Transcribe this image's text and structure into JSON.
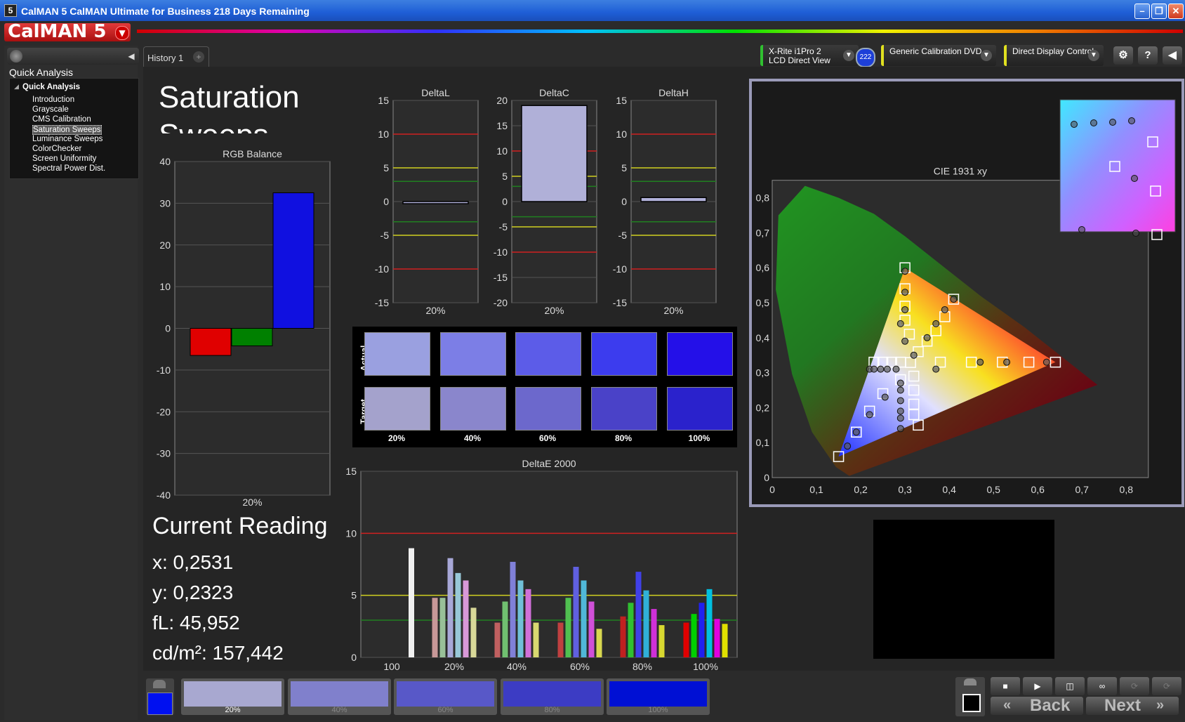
{
  "window": {
    "title": "CalMAN 5 CalMAN Ultimate for Business 218 Days Remaining",
    "app_icon": "5"
  },
  "logo": {
    "text": "CalMAN 5"
  },
  "tabs": [
    {
      "label": "History 1"
    }
  ],
  "left_panel": {
    "header": "Quick Analysis",
    "tree_header": "Quick Analysis",
    "items": [
      "Introduction",
      "Grayscale",
      "CMS Calibration",
      "Saturation Sweeps",
      "Luminance Sweeps",
      "ColorChecker",
      "Screen Uniformity",
      "Spectral Power Dist."
    ],
    "selected": "Saturation Sweeps"
  },
  "devices": {
    "meter": {
      "line1": "X-Rite i1Pro 2",
      "line2": "LCD Direct View",
      "badge": "222"
    },
    "source": {
      "label": "Generic Calibration DVD"
    },
    "display": {
      "label": "Direct Display Control"
    }
  },
  "page": {
    "title_line1": "Saturation",
    "title_line2": "Sweeps"
  },
  "current_reading": {
    "title": "Current Reading",
    "x": "x: 0,2531",
    "y": "y: 0,2323",
    "fl": "fL: 45,952",
    "cdm2": "cd/m²: 157,442"
  },
  "swatch_labels": {
    "actual": "Actual",
    "target": "Target",
    "steps": [
      "20%",
      "40%",
      "60%",
      "80%",
      "100%"
    ]
  },
  "swatch_colors": {
    "actual": [
      "#9aa0e0",
      "#7c7ee6",
      "#5c5ce8",
      "#3c3cee",
      "#2410e8"
    ],
    "target": [
      "#a4a2cc",
      "#8a86cc",
      "#6c68cc",
      "#4a42c8",
      "#2a22cc"
    ]
  },
  "patches": {
    "current_color": "#0010f0",
    "labels": [
      "20%",
      "40%",
      "60%",
      "80%",
      "100%"
    ],
    "colors": [
      "#a8a8d0",
      "#8080cc",
      "#5858c8",
      "#3c3cc4",
      "#0010d4"
    ]
  },
  "nav": {
    "back": "Back",
    "next": "Next"
  },
  "chart_data": [
    {
      "type": "bar",
      "title": "RGB Balance",
      "categories": [
        "20%"
      ],
      "series": [
        {
          "color": "#e00000",
          "values": [
            -6.5
          ]
        },
        {
          "color": "#008000",
          "values": [
            -4.2
          ]
        },
        {
          "color": "#1010e0",
          "values": [
            32.5
          ]
        }
      ],
      "ylim": [
        -40,
        40
      ],
      "yticks": [
        40,
        30,
        20,
        10,
        0,
        -10,
        -20,
        -30,
        -40
      ]
    },
    {
      "type": "bar",
      "title": "DeltaL",
      "categories": [
        "20%"
      ],
      "values": [
        -0.3
      ],
      "ylim": [
        -15,
        15
      ],
      "yticks": [
        15,
        10,
        5,
        0,
        -5,
        -10,
        -15
      ],
      "reference_lines": [
        {
          "y": 10,
          "color": "#d02020"
        },
        {
          "y": 5,
          "color": "#d0d020"
        },
        {
          "y": 3,
          "color": "#208020"
        },
        {
          "y": -3,
          "color": "#208020"
        },
        {
          "y": -5,
          "color": "#d0d020"
        },
        {
          "y": -10,
          "color": "#d02020"
        }
      ]
    },
    {
      "type": "bar",
      "title": "DeltaC",
      "categories": [
        "20%"
      ],
      "values": [
        19
      ],
      "ylim": [
        -20,
        20
      ],
      "yticks": [
        20,
        15,
        10,
        5,
        0,
        -5,
        -10,
        -15,
        -20
      ],
      "reference_lines": [
        {
          "y": 10,
          "color": "#d02020"
        },
        {
          "y": 5,
          "color": "#d0d020"
        },
        {
          "y": 3,
          "color": "#208020"
        },
        {
          "y": -3,
          "color": "#208020"
        },
        {
          "y": -5,
          "color": "#d0d020"
        },
        {
          "y": -10,
          "color": "#d02020"
        }
      ]
    },
    {
      "type": "bar",
      "title": "DeltaH",
      "categories": [
        "20%"
      ],
      "values": [
        0.6
      ],
      "ylim": [
        -15,
        15
      ],
      "yticks": [
        15,
        10,
        5,
        0,
        -5,
        -10,
        -15
      ],
      "reference_lines": [
        {
          "y": 10,
          "color": "#d02020"
        },
        {
          "y": 5,
          "color": "#d0d020"
        },
        {
          "y": 3,
          "color": "#208020"
        },
        {
          "y": -3,
          "color": "#208020"
        },
        {
          "y": -5,
          "color": "#d0d020"
        },
        {
          "y": -10,
          "color": "#d02020"
        }
      ]
    },
    {
      "type": "bar",
      "title": "DeltaE 2000",
      "categories": [
        "100",
        "20%",
        "40%",
        "60%",
        "80%",
        "100%"
      ],
      "ylim": [
        0,
        15
      ],
      "yticks": [
        15,
        10,
        5,
        0
      ],
      "reference_lines": [
        {
          "y": 10,
          "color": "#d02020"
        },
        {
          "y": 5,
          "color": "#d0d020"
        },
        {
          "y": 3,
          "color": "#208020"
        }
      ],
      "groups": [
        {
          "bars": [
            {
              "v": 8.8,
              "c": "#f0f0f0"
            }
          ]
        },
        {
          "bars": [
            {
              "v": 4.8,
              "c": "#c89898"
            },
            {
              "v": 4.8,
              "c": "#98c098"
            },
            {
              "v": 8.0,
              "c": "#a8a8d8"
            },
            {
              "v": 6.8,
              "c": "#98c8d8"
            },
            {
              "v": 6.2,
              "c": "#d898d8"
            },
            {
              "v": 4.0,
              "c": "#d8d898"
            }
          ]
        },
        {
          "bars": [
            {
              "v": 2.8,
              "c": "#c06060"
            },
            {
              "v": 4.5,
              "c": "#70c070"
            },
            {
              "v": 7.7,
              "c": "#8080d8"
            },
            {
              "v": 6.2,
              "c": "#70c0d8"
            },
            {
              "v": 5.5,
              "c": "#d070d8"
            },
            {
              "v": 2.8,
              "c": "#d8d870"
            }
          ]
        },
        {
          "bars": [
            {
              "v": 2.8,
              "c": "#c04040"
            },
            {
              "v": 4.8,
              "c": "#50c050"
            },
            {
              "v": 7.3,
              "c": "#6060e0"
            },
            {
              "v": 6.2,
              "c": "#50b8d8"
            },
            {
              "v": 4.5,
              "c": "#d050d8"
            },
            {
              "v": 2.3,
              "c": "#d8d850"
            }
          ]
        },
        {
          "bars": [
            {
              "v": 3.3,
              "c": "#c02020"
            },
            {
              "v": 4.4,
              "c": "#30c030"
            },
            {
              "v": 6.9,
              "c": "#4040e8"
            },
            {
              "v": 5.4,
              "c": "#30b0d8"
            },
            {
              "v": 3.9,
              "c": "#d030d8"
            },
            {
              "v": 2.6,
              "c": "#d8d830"
            }
          ]
        },
        {
          "bars": [
            {
              "v": 2.8,
              "c": "#e00000"
            },
            {
              "v": 3.5,
              "c": "#00d000"
            },
            {
              "v": 4.4,
              "c": "#2020f0"
            },
            {
              "v": 5.5,
              "c": "#00c0e0"
            },
            {
              "v": 3.1,
              "c": "#e000e0"
            },
            {
              "v": 2.7,
              "c": "#e0e000"
            }
          ]
        }
      ]
    },
    {
      "type": "scatter",
      "title": "CIE 1931 xy",
      "xlim": [
        0,
        0.85
      ],
      "ylim": [
        0,
        0.85
      ],
      "xticks": [
        "0",
        "0,1",
        "0,2",
        "0,3",
        "0,4",
        "0,5",
        "0,6",
        "0,7",
        "0,8"
      ],
      "yticks": [
        "0",
        "0,1",
        "0,2",
        "0,3",
        "0,4",
        "0,5",
        "0,6",
        "0,7",
        "0,8"
      ],
      "gamut": [
        [
          0.64,
          0.33
        ],
        [
          0.3,
          0.6
        ],
        [
          0.15,
          0.06
        ]
      ],
      "targets": [
        [
          0.3,
          0.6
        ],
        [
          0.3,
          0.54
        ],
        [
          0.3,
          0.49
        ],
        [
          0.3,
          0.45
        ],
        [
          0.31,
          0.41
        ],
        [
          0.41,
          0.51
        ],
        [
          0.39,
          0.46
        ],
        [
          0.37,
          0.42
        ],
        [
          0.35,
          0.39
        ],
        [
          0.33,
          0.36
        ],
        [
          0.64,
          0.33
        ],
        [
          0.58,
          0.33
        ],
        [
          0.52,
          0.33
        ],
        [
          0.45,
          0.33
        ],
        [
          0.38,
          0.33
        ],
        [
          0.3127,
          0.329
        ],
        [
          0.29,
          0.28
        ],
        [
          0.25,
          0.24
        ],
        [
          0.22,
          0.19
        ],
        [
          0.19,
          0.13
        ],
        [
          0.15,
          0.06
        ],
        [
          0.32,
          0.29
        ],
        [
          0.32,
          0.25
        ],
        [
          0.32,
          0.21
        ],
        [
          0.32,
          0.18
        ],
        [
          0.33,
          0.15
        ],
        [
          0.23,
          0.33
        ],
        [
          0.25,
          0.33
        ],
        [
          0.27,
          0.33
        ],
        [
          0.29,
          0.33
        ]
      ],
      "measured": [
        [
          0.3,
          0.59
        ],
        [
          0.3,
          0.53
        ],
        [
          0.3,
          0.48
        ],
        [
          0.29,
          0.44
        ],
        [
          0.3,
          0.39
        ],
        [
          0.41,
          0.51
        ],
        [
          0.39,
          0.48
        ],
        [
          0.37,
          0.44
        ],
        [
          0.35,
          0.4
        ],
        [
          0.32,
          0.35
        ],
        [
          0.62,
          0.33
        ],
        [
          0.53,
          0.33
        ],
        [
          0.47,
          0.33
        ],
        [
          0.37,
          0.31
        ],
        [
          0.22,
          0.31
        ],
        [
          0.23,
          0.31
        ],
        [
          0.245,
          0.31
        ],
        [
          0.26,
          0.31
        ],
        [
          0.28,
          0.31
        ],
        [
          0.29,
          0.27
        ],
        [
          0.29,
          0.25
        ],
        [
          0.29,
          0.22
        ],
        [
          0.29,
          0.19
        ],
        [
          0.29,
          0.17
        ],
        [
          0.29,
          0.14
        ],
        [
          0.255,
          0.23
        ],
        [
          0.22,
          0.18
        ],
        [
          0.19,
          0.13
        ],
        [
          0.17,
          0.09
        ]
      ]
    }
  ]
}
